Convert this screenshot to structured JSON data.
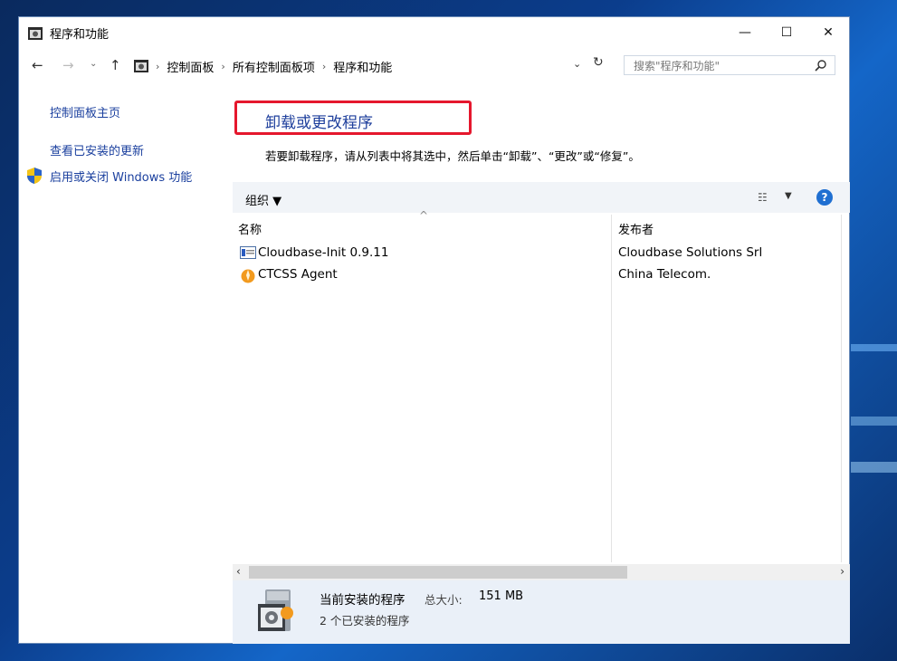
{
  "window": {
    "title": "程序和功能",
    "controls": {
      "minimize": "—",
      "maximize": "☐",
      "close": "✕"
    }
  },
  "address_bar": {
    "breadcrumbs": [
      "控制面板",
      "所有控制面板项",
      "程序和功能"
    ],
    "search_placeholder": "搜索\"程序和功能\""
  },
  "sidebar": {
    "home": "控制面板主页",
    "updates": "查看已安装的更新",
    "features": "启用或关闭 Windows 功能"
  },
  "main": {
    "title": "卸载或更改程序",
    "description": "若要卸载程序，请从列表中将其选中，然后单击“卸载”、“更改”或“修复”。"
  },
  "toolbar": {
    "organize": "组织 ▼",
    "help": "?"
  },
  "columns": {
    "name": "名称",
    "publisher": "发布者"
  },
  "programs": [
    {
      "name": "Cloudbase-Init 0.9.11",
      "publisher": "Cloudbase Solutions Srl",
      "icon": "installer-icon"
    },
    {
      "name": "CTCSS Agent",
      "publisher": "China Telecom.",
      "icon": "agent-icon"
    }
  ],
  "details": {
    "title": "当前安装的程序",
    "size_label": "总大小:",
    "size_value": "151 MB",
    "count": "2 个已安装的程序"
  },
  "colors": {
    "link": "#1a3f9e",
    "highlight": "#e5172d",
    "toolbar_bg": "#f1f4f8",
    "details_bg": "#eaf0f8"
  }
}
